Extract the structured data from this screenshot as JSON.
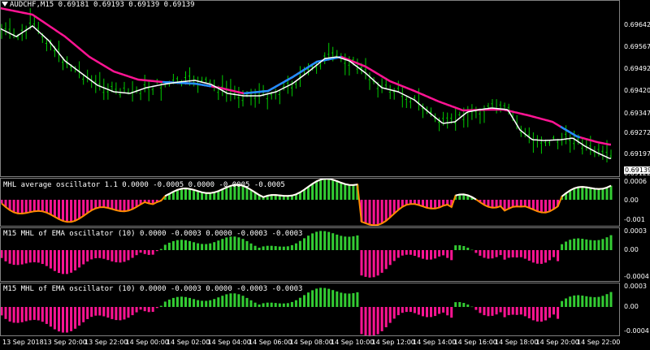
{
  "main": {
    "symbol_title": "AUDCHF,M15",
    "ohlc": "0.69181 0.69193 0.69139 0.69139",
    "price_ticks": [
      "0.69642",
      "0.69567",
      "0.69492",
      "0.69420",
      "0.69347",
      "0.69272",
      "0.69197",
      "0.69122"
    ],
    "current_price": "0.69139"
  },
  "panels": [
    {
      "title": "MHL average oscillator 1.1 0.0000 -0.0005 0.0000 -0.0005 -0.0005",
      "ticks": [
        "0.0006",
        "0.00",
        "-0.001"
      ]
    },
    {
      "title": "M15 MHL of EMA oscillator (10) 0.0000 -0.0003 0.0000 -0.0003 -0.0003",
      "ticks": [
        "0.0003",
        "0.00",
        "-0.0004"
      ]
    },
    {
      "title": "M15 MHL of EMA oscillator (10) 0.0000 -0.0003 0.0000 -0.0003 -0.0003",
      "ticks": [
        "0.0003",
        "0.00",
        "-0.0004"
      ]
    }
  ],
  "time_axis": [
    "13 Sep 2018",
    "13 Sep 20:00",
    "13 Sep 22:00",
    "14 Sep 00:00",
    "14 Sep 02:00",
    "14 Sep 04:00",
    "14 Sep 06:00",
    "14 Sep 08:00",
    "14 Sep 10:00",
    "14 Sep 12:00",
    "14 Sep 14:00",
    "14 Sep 16:00",
    "14 Sep 18:00",
    "14 Sep 20:00",
    "14 Sep 22:00"
  ],
  "colors": {
    "candles": "#00cc00",
    "white_line": "#ffffff",
    "pink_line": "#ff1493",
    "blue_line": "#1e90ff",
    "pos_hist": "#33cc33",
    "neg_hist": "#ff1493",
    "orange": "#ff8c00",
    "grid": "#808080"
  }
}
